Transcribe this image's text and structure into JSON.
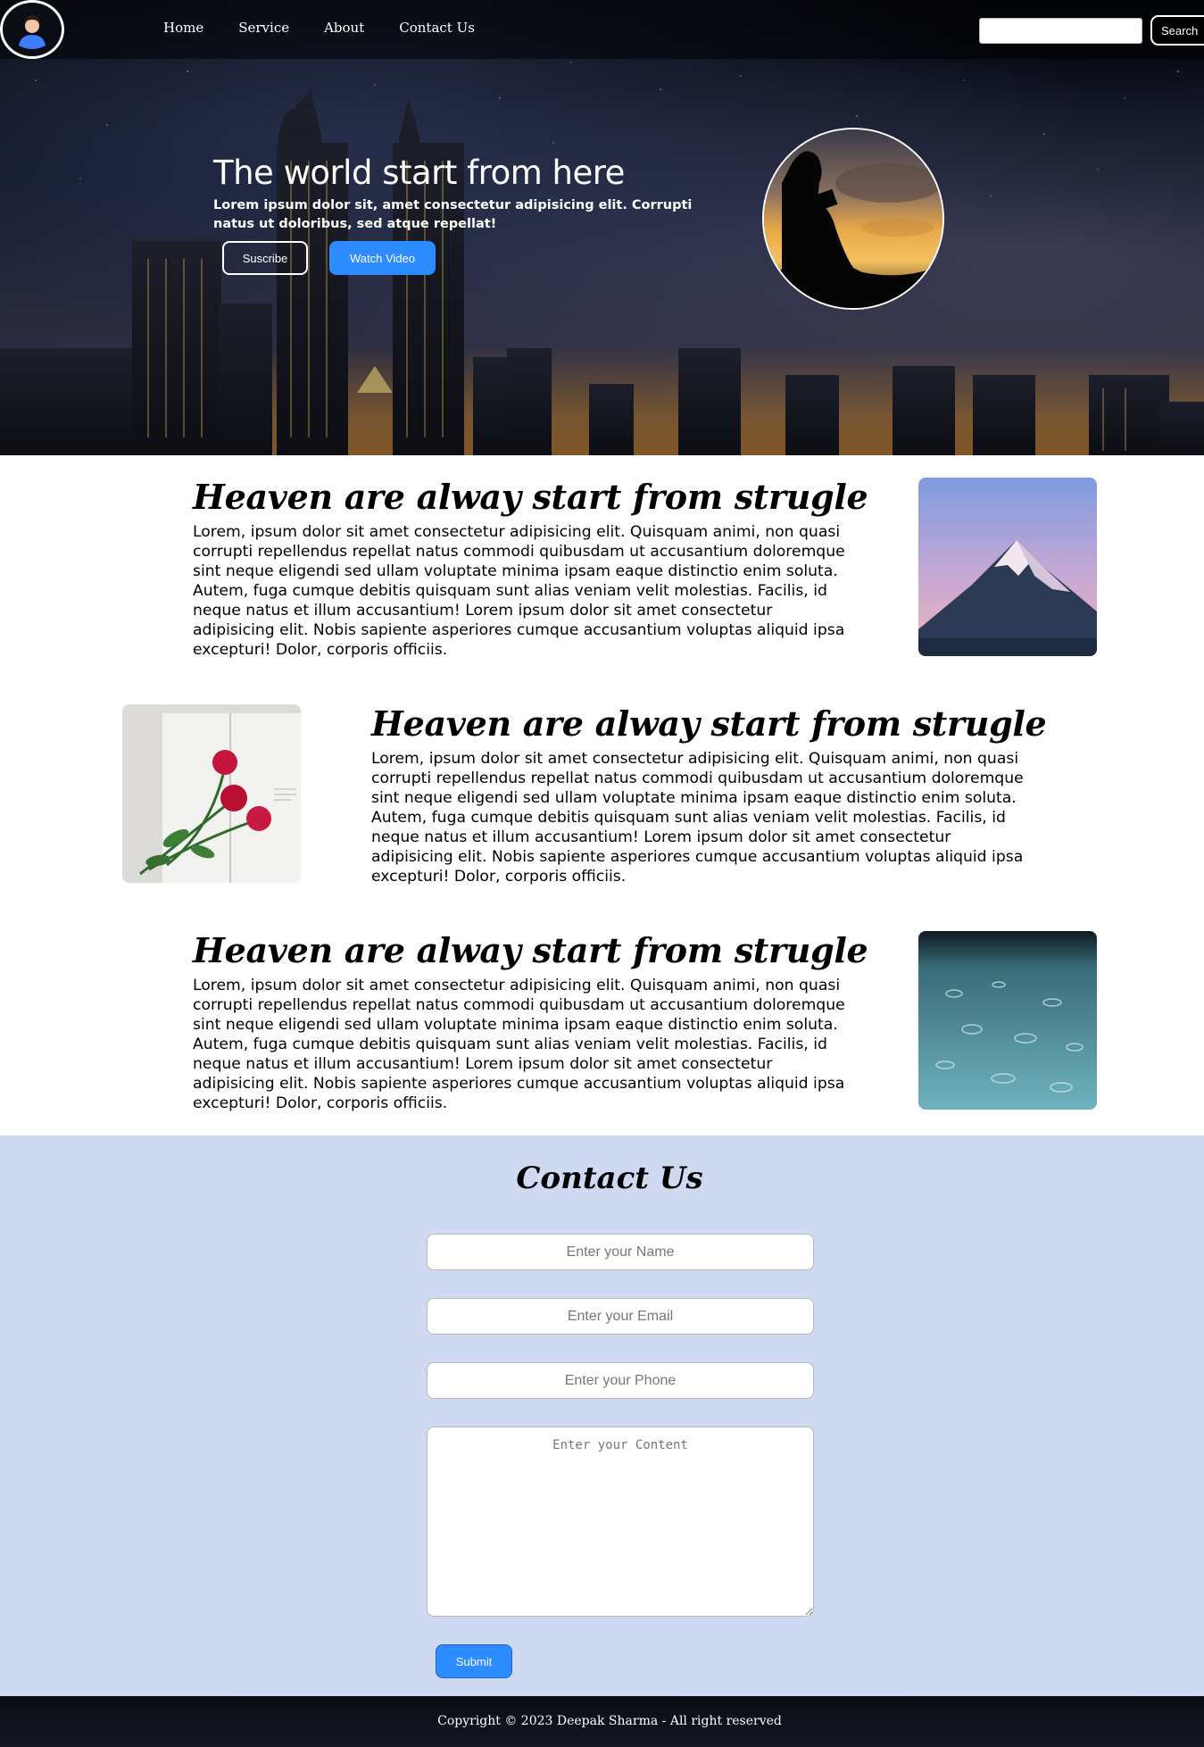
{
  "nav": {
    "links": [
      "Home",
      "Service",
      "About",
      "Contact Us"
    ],
    "search_placeholder": "",
    "search_button": "Search"
  },
  "hero": {
    "title": "The world start from here",
    "subtitle": "Lorem ipsum dolor sit, amet consectetur adipisicing elit. Corrupti natus ut doloribus, sed atque repellat!",
    "subscribe_button": "Suscribe",
    "watch_button": "Watch Video"
  },
  "articles": [
    {
      "title": "Heaven are alway start from strugle",
      "body": "Lorem, ipsum dolor sit amet consectetur adipisicing elit. Quisquam animi, non quasi corrupti repellendus repellat natus commodi quibusdam ut accusantium doloremque sint neque eligendi sed ullam voluptate minima ipsam eaque distinctio enim soluta. Autem, fuga cumque debitis quisquam sunt alias veniam velit molestias. Facilis, id neque natus et illum accusantium! Lorem ipsum dolor sit amet consectetur adipisicing elit. Nobis sapiente asperiores cumque accusantium voluptas aliquid ipsa excepturi! Dolor, corporis officiis.",
      "image": "mountain-image"
    },
    {
      "title": "Heaven are alway start from strugle",
      "body": "Lorem, ipsum dolor sit amet consectetur adipisicing elit. Quisquam animi, non quasi corrupti repellendus repellat natus commodi quibusdam ut accusantium doloremque sint neque eligendi sed ullam voluptate minima ipsam eaque distinctio enim soluta. Autem, fuga cumque debitis quisquam sunt alias veniam velit molestias. Facilis, id neque natus et illum accusantium! Lorem ipsum dolor sit amet consectetur adipisicing elit. Nobis sapiente asperiores cumque accusantium voluptas aliquid ipsa excepturi! Dolor, corporis officiis.",
      "image": "roses-image"
    },
    {
      "title": "Heaven are alway start from strugle",
      "body": "Lorem, ipsum dolor sit amet consectetur adipisicing elit. Quisquam animi, non quasi corrupti repellendus repellat natus commodi quibusdam ut accusantium doloremque sint neque eligendi sed ullam voluptate minima ipsam eaque distinctio enim soluta. Autem, fuga cumque debitis quisquam sunt alias veniam velit molestias. Facilis, id neque natus et illum accusantium! Lorem ipsum dolor sit amet consectetur adipisicing elit. Nobis sapiente asperiores cumque accusantium voluptas aliquid ipsa excepturi! Dolor, corporis officiis.",
      "image": "rain-water-image"
    }
  ],
  "contact": {
    "title": "Contact Us",
    "name_placeholder": "Enter your Name",
    "email_placeholder": "Enter your Email",
    "phone_placeholder": "Enter your Phone",
    "content_placeholder": "Enter your Content",
    "submit_button": "Submit"
  },
  "footer": {
    "copyright": "Copyright © 2023 Deepak Sharma - All right reserved"
  },
  "colors": {
    "accent": "#2d8cff",
    "contact_bg": "#cfd9f1",
    "nav_bg": "#000000"
  }
}
